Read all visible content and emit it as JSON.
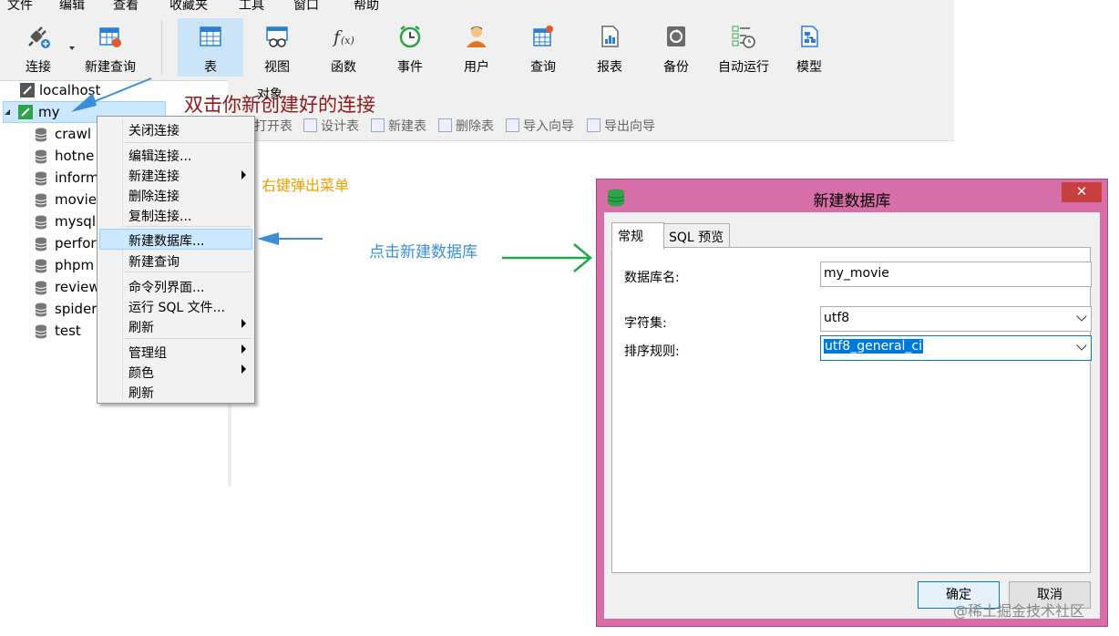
{
  "menu": [
    "文件",
    "编辑",
    "查看",
    "收藏夹",
    "工具",
    "窗口",
    "帮助"
  ],
  "toolbar": {
    "connect": "连接",
    "new_query": "新建查询",
    "table": "表",
    "view": "视图",
    "function": "函数",
    "event": "事件",
    "user": "用户",
    "query": "查询",
    "report": "报表",
    "backup": "备份",
    "auto_run": "自动运行",
    "model": "模型"
  },
  "object_tab": "对象",
  "subtoolbar": [
    "打开表",
    "设计表",
    "新建表",
    "删除表",
    "导入向导",
    "导出向导"
  ],
  "tree": {
    "server": "localhost",
    "connection": "my",
    "databases": [
      "crawl",
      "hotne",
      "inform",
      "movie",
      "mysql",
      "perfor",
      "phpm",
      "review",
      "spider",
      "test"
    ]
  },
  "context_menu": {
    "close_connection": "关闭连接",
    "edit_connection": "编辑连接...",
    "new_connection": "新建连接",
    "delete_connection": "删除连接",
    "copy_connection": "复制连接...",
    "new_database": "新建数据库...",
    "new_query": "新建查询",
    "command_line": "命令列界面...",
    "run_sql": "运行 SQL 文件...",
    "refresh": "刷新",
    "manage_group": "管理组",
    "color": "颜色",
    "refresh2": "刷新"
  },
  "annotations": {
    "double_click": "双击你新创建好的连接",
    "right_click": "右键弹出菜单",
    "click_new_db": "点击新建数据库"
  },
  "dialog": {
    "title": "新建数据库",
    "close": "✕",
    "tab_general": "常规",
    "tab_sql": "SQL 预览",
    "db_name_label": "数据库名:",
    "db_name_value": "my_movie",
    "charset_label": "字符集:",
    "charset_value": "utf8",
    "collation_label": "排序规则:",
    "collation_value": "utf8_general_ci",
    "ok": "确定",
    "cancel": "取消"
  },
  "watermark": "@稀土掘金技术社区",
  "colors": {
    "dialog_frame": "#d86ea8",
    "annotation_dark_red": "#8b1a1a",
    "annotation_orange": "#e8a000",
    "annotation_blue": "#3a8fd6",
    "arrow_green": "#21a849",
    "arrow_blue": "#3a8fd6"
  }
}
